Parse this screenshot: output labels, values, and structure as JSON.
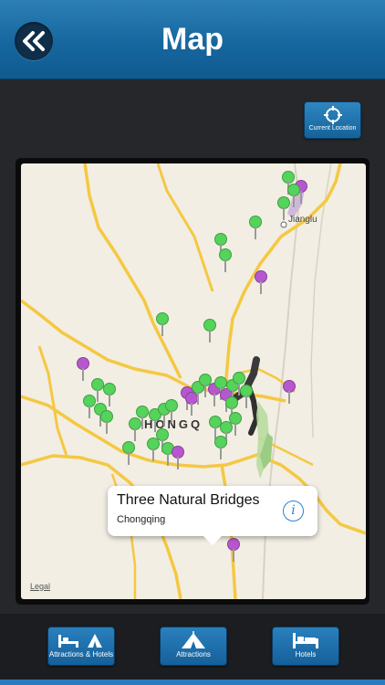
{
  "header": {
    "title": "Map",
    "back_icon": "double-chevron-left-icon"
  },
  "toolbar": {
    "current_location_label": "Current Location"
  },
  "map": {
    "city_label": "HONGQ",
    "town_label": "Jianglu",
    "legal_label": "Legal",
    "callout": {
      "title": "Three Natural Bridges",
      "subtitle": "Chongqing",
      "info_icon": "i"
    }
  },
  "tabs": [
    {
      "label": "Attractions & Hotels",
      "icon": "bed-and-tent-icon"
    },
    {
      "label": "Attractions",
      "icon": "tent-icon"
    },
    {
      "label": "Hotels",
      "icon": "bed-icon"
    }
  ],
  "colors": {
    "nav": "#16679f",
    "pin_attraction": "#54d45a",
    "pin_hotel": "#b757cf",
    "road": "#f5c842"
  }
}
